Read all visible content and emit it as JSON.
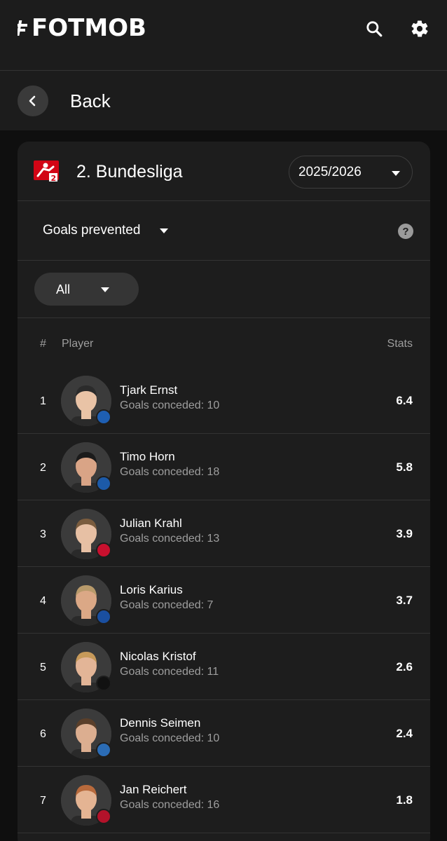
{
  "app": {
    "logo_text": "FOTMOB"
  },
  "header": {
    "search_icon": "search-icon",
    "settings_icon": "gear-icon"
  },
  "nav": {
    "back_label": "Back"
  },
  "league": {
    "name": "2. Bundesliga",
    "season": "2025/2026"
  },
  "stat": {
    "selected": "Goals prevented"
  },
  "filter": {
    "selected": "All"
  },
  "table": {
    "headers": {
      "rank": "#",
      "player": "Player",
      "stats": "Stats"
    },
    "rows": [
      {
        "rank": "1",
        "name": "Tjark Ernst",
        "detail": "Goals conceded: 10",
        "value": "6.4",
        "badge_color": "#1e5fb3",
        "skin": "#e9c3a6",
        "hair": "#2b2b2b"
      },
      {
        "rank": "2",
        "name": "Timo Horn",
        "detail": "Goals conceded: 18",
        "value": "5.8",
        "badge_color": "#1c5aa8",
        "skin": "#d9a486",
        "hair": "#1b1b1b"
      },
      {
        "rank": "3",
        "name": "Julian Krahl",
        "detail": "Goals conceded: 13",
        "value": "3.9",
        "badge_color": "#c8102e",
        "skin": "#e7c0a4",
        "hair": "#7a5c3e"
      },
      {
        "rank": "4",
        "name": "Loris Karius",
        "detail": "Goals conceded: 7",
        "value": "3.7",
        "badge_color": "#1a4fa0",
        "skin": "#dba886",
        "hair": "#b89a6b"
      },
      {
        "rank": "5",
        "name": "Nicolas Kristof",
        "detail": "Goals conceded: 11",
        "value": "2.6",
        "badge_color": "#111111",
        "skin": "#e3b597",
        "hair": "#c79a5a"
      },
      {
        "rank": "6",
        "name": "Dennis Seimen",
        "detail": "Goals conceded: 10",
        "value": "2.4",
        "badge_color": "#2b6cb5",
        "skin": "#dcae90",
        "hair": "#5a3f2a"
      },
      {
        "rank": "7",
        "name": "Jan Reichert",
        "detail": "Goals conceded: 16",
        "value": "1.8",
        "badge_color": "#b3122a",
        "skin": "#e4b493",
        "hair": "#b86a3c"
      }
    ]
  }
}
